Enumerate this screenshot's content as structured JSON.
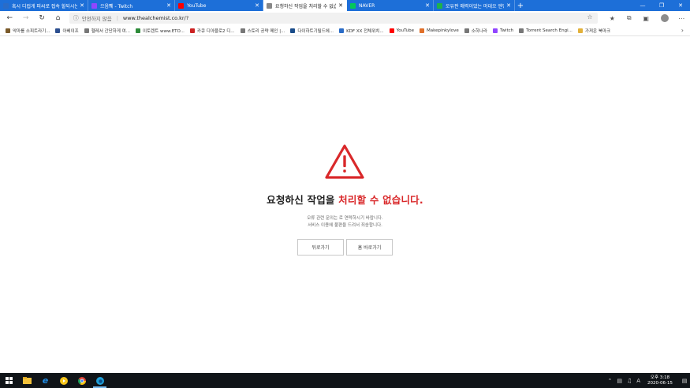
{
  "tabs": [
    {
      "label": "혹시 디럽게 피씨로 접속 할되시는 분 계신",
      "active": false,
      "fav_color": "#2a6cc7",
      "icon": "page-icon"
    },
    {
      "label": "으음쀄 - Twitch",
      "active": false,
      "fav_color": "#9146ff",
      "icon": "twitch-icon"
    },
    {
      "label": "YouTube",
      "active": false,
      "fav_color": "#ff0000",
      "icon": "youtube-icon"
    },
    {
      "label": "요청하신 작업을 처리할 수 없습니다",
      "active": true,
      "fav_color": "#888888",
      "icon": "page-icon"
    },
    {
      "label": "NAVER",
      "active": false,
      "fav_color": "#03c75a",
      "icon": "naver-icon"
    },
    {
      "label": "오유판 매력이었는 머대오 엔딩곡",
      "active": false,
      "fav_color": "#1fb24a",
      "icon": "page-icon"
    }
  ],
  "address": {
    "security_text": "안전하지 않음",
    "url": "www.thealchemist.co.kr/?"
  },
  "bookmarks": [
    {
      "label": "악마를 소피트라기...",
      "color": "#7a5a2a"
    },
    {
      "label": "아베이프",
      "color": "#2c4f8f"
    },
    {
      "label": "헬레서 간단하게 여...",
      "color": "#777777"
    },
    {
      "label": "이토렌트 www.ETO...",
      "color": "#2e8b3a"
    },
    {
      "label": "카큐 디아블로2 디...",
      "color": "#cc2222"
    },
    {
      "label": "스토리 공략 메인 |...",
      "color": "#777777"
    },
    {
      "label": "다이하트기릴드에...",
      "color": "#1a4c8a"
    },
    {
      "label": "KDF XX 전체위치...",
      "color": "#2a6cc7"
    },
    {
      "label": "YouTube",
      "color": "#ff0000"
    },
    {
      "label": "Makepinkylove",
      "color": "#e0702a"
    },
    {
      "label": "소히나라",
      "color": "#777777"
    },
    {
      "label": "Twitch",
      "color": "#9146ff"
    },
    {
      "label": "Torrent Search Engi...",
      "color": "#777777"
    },
    {
      "label": "가져온 북마크",
      "color": "#e2b13a"
    }
  ],
  "error": {
    "title_normal": "요청하신 작업을",
    "title_highlight": "처리할 수 없습니다.",
    "line1": "오류 관련 문의는 로 연락하시기 바랍니다.",
    "line2": "서비스 이용에 불편을 드려서 죄송합니다.",
    "back_label": "뒤로가기",
    "home_label": "홈 바로가기",
    "accent_color": "#d9282a"
  },
  "clock": {
    "time": "오후 3:18",
    "date": "2020-06-15"
  }
}
